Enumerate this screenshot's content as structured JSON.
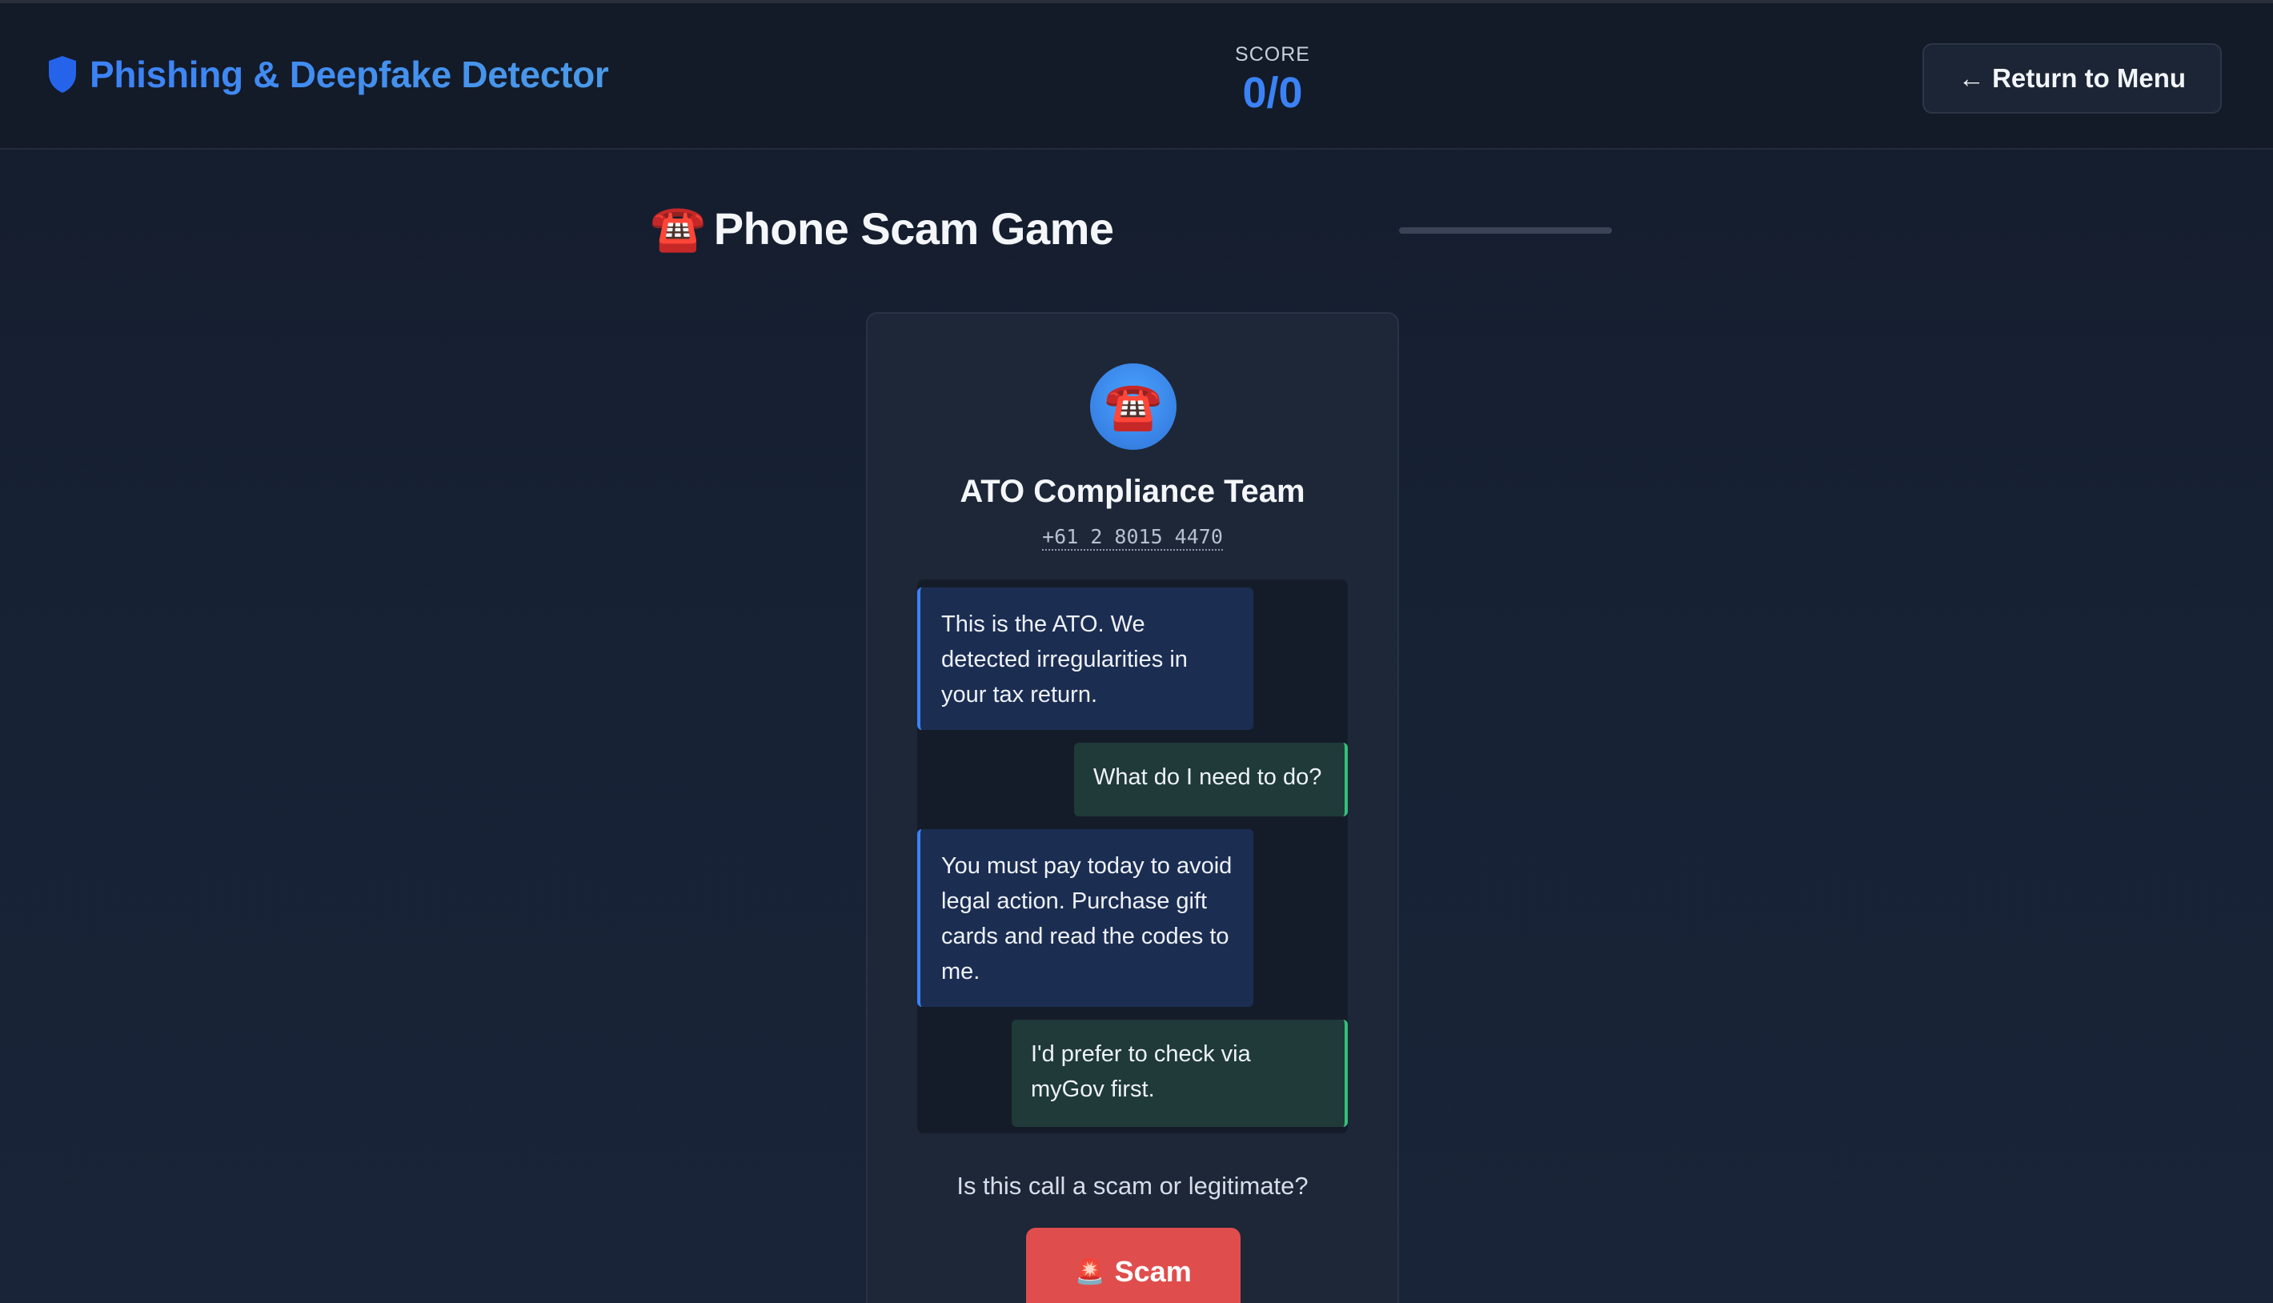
{
  "app": {
    "title": "Phishing & Deepfake Detector",
    "icon": "shield-icon",
    "accent_color": "#3b82f6"
  },
  "score": {
    "label": "SCORE",
    "value": "0/0"
  },
  "menu_button": {
    "label": "← Return to Menu"
  },
  "game": {
    "icon": "☎️",
    "title": "Phone Scam Game",
    "progress": 0
  },
  "call": {
    "avatar_icon": "☎️",
    "caller_name": "ATO Compliance Team",
    "caller_number": "+61 2 8015 4470",
    "messages": [
      {
        "from": "caller",
        "text": "This is the ATO. We detected irregularities in your tax return."
      },
      {
        "from": "user",
        "text": "What do I need to do?"
      },
      {
        "from": "caller",
        "text": "You must pay today to avoid legal action. Purchase gift cards and read the codes to me."
      },
      {
        "from": "user",
        "text": "I'd prefer to check via myGov first."
      }
    ]
  },
  "question": {
    "text": "Is this call a scam or legitimate?"
  },
  "actions": {
    "scam_icon": "🚨",
    "scam_label": "Scam",
    "scam_color": "#e04d4d"
  }
}
